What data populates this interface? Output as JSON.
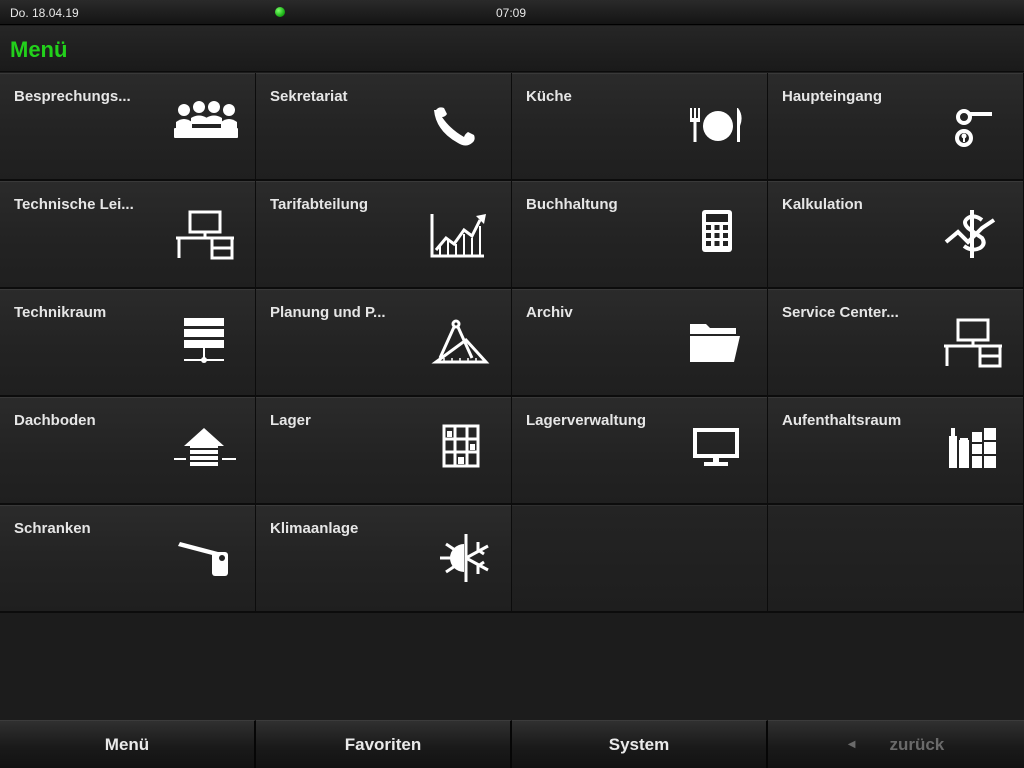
{
  "statusbar": {
    "date": "Do. 18.04.19",
    "time": "07:09",
    "status_color": "#22d11b"
  },
  "header": {
    "title": "Menü",
    "accent_color": "#22d11b"
  },
  "tiles": [
    {
      "label": "Besprechungs...",
      "icon": "meeting-icon"
    },
    {
      "label": "Sekretariat",
      "icon": "phone-icon"
    },
    {
      "label": "Küche",
      "icon": "plate-cutlery-icon"
    },
    {
      "label": "Haupteingang",
      "icon": "door-handle-lock-icon"
    },
    {
      "label": "Technische Lei...",
      "icon": "desk-computer-icon"
    },
    {
      "label": "Tarifabteilung",
      "icon": "chart-growth-icon"
    },
    {
      "label": "Buchhaltung",
      "icon": "calculator-icon"
    },
    {
      "label": "Kalkulation",
      "icon": "dollar-chart-icon"
    },
    {
      "label": "Technikraum",
      "icon": "server-icon"
    },
    {
      "label": "Planung und P...",
      "icon": "compass-ruler-icon"
    },
    {
      "label": "Archiv",
      "icon": "folder-icon"
    },
    {
      "label": "Service Center...",
      "icon": "desk-computer-icon"
    },
    {
      "label": "Dachboden",
      "icon": "attic-house-icon"
    },
    {
      "label": "Lager",
      "icon": "shelf-icon"
    },
    {
      "label": "Lagerverwaltung",
      "icon": "monitor-icon"
    },
    {
      "label": "Aufenthaltsraum",
      "icon": "drinks-icon"
    },
    {
      "label": "Schranken",
      "icon": "barrier-icon"
    },
    {
      "label": "Klimaanlage",
      "icon": "snowflake-sun-icon"
    }
  ],
  "bottombar": {
    "menu": "Menü",
    "favorites": "Favoriten",
    "system": "System",
    "back": "zurück"
  }
}
